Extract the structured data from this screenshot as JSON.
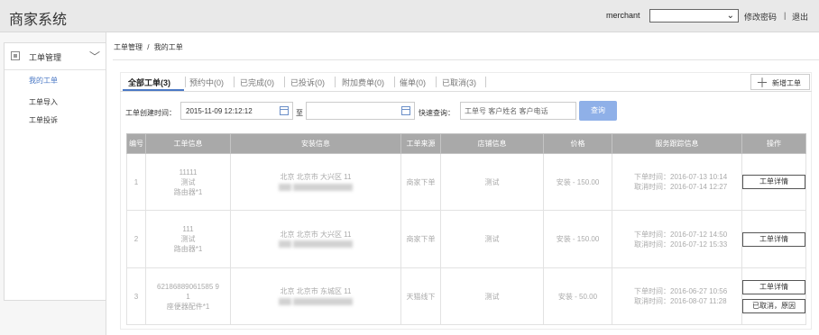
{
  "header": {
    "app_title": "商家系统",
    "username": "merchant",
    "user_select_value": "",
    "change_password": "修改密码",
    "separator": "|",
    "logout": "退出"
  },
  "sidebar": {
    "section_label": "工单管理",
    "items": [
      {
        "label": "我的工单",
        "active": true
      },
      {
        "label": "工单导入",
        "active": false
      },
      {
        "label": "工单投诉",
        "active": false
      }
    ]
  },
  "breadcrumb": {
    "root": "工单管理",
    "separator": "/",
    "current": "我的工单"
  },
  "tabs": [
    {
      "label": "全部工单(3)",
      "active": true
    },
    {
      "label": "预约中(0)"
    },
    {
      "label": "已完成(0)"
    },
    {
      "label": "已投诉(0)"
    },
    {
      "label": "附加费单(0)"
    },
    {
      "label": "催单(0)"
    },
    {
      "label": "已取消(3)"
    }
  ],
  "add_button_label": "新增工单",
  "filters": {
    "created_label": "工单创建时间：",
    "start_date": "2015-11-09 12:12:12",
    "end_date": "",
    "to_label": "至",
    "quick_label": "快速查询：",
    "search_placeholder": "工单号 客户姓名 客户电话",
    "query_label": "查询"
  },
  "table": {
    "columns": [
      "编号",
      "工单信息",
      "安装信息",
      "工单来源",
      "店铺信息",
      "价格",
      "服务跟踪信息",
      "操作"
    ],
    "rows": [
      {
        "no": "1",
        "order_lines": [
          "11111",
          "测试",
          "路由器*1"
        ],
        "install_address": "北京 北京市 大兴区 11",
        "source": "商家下单",
        "shop": "测试",
        "price": "安装 - 150.00",
        "tracking": [
          "下单时间：2016-07-13 10:14",
          "取消时间：2016-07-14 12:27"
        ],
        "actions": [
          "工单详情"
        ]
      },
      {
        "no": "2",
        "order_lines": [
          "111",
          "测试",
          "路由器*1"
        ],
        "install_address": "北京 北京市 大兴区 11",
        "source": "商家下单",
        "shop": "测试",
        "price": "安装 - 150.00",
        "tracking": [
          "下单时间：2016-07-12 14:50",
          "取消时间：2016-07-12 15:33"
        ],
        "actions": [
          "工单详情"
        ]
      },
      {
        "no": "3",
        "order_lines": [
          "62186889061585 9",
          "1",
          "座便器配件*1"
        ],
        "install_address": "北京 北京市 东城区 11",
        "source": "天猫线下",
        "shop": "测试",
        "price": "安装 - 50.00",
        "tracking": [
          "下单时间：2016-06-27 10:56",
          "取消时间：2016-08-07 11:28"
        ],
        "actions": [
          "工单详情",
          "已取消，原因"
        ]
      }
    ]
  },
  "colors": {
    "accent": "#4b79c5",
    "query_button": "#8fb0e8",
    "table_header": "#a9a9a9",
    "topbar": "#e9e9e9"
  }
}
